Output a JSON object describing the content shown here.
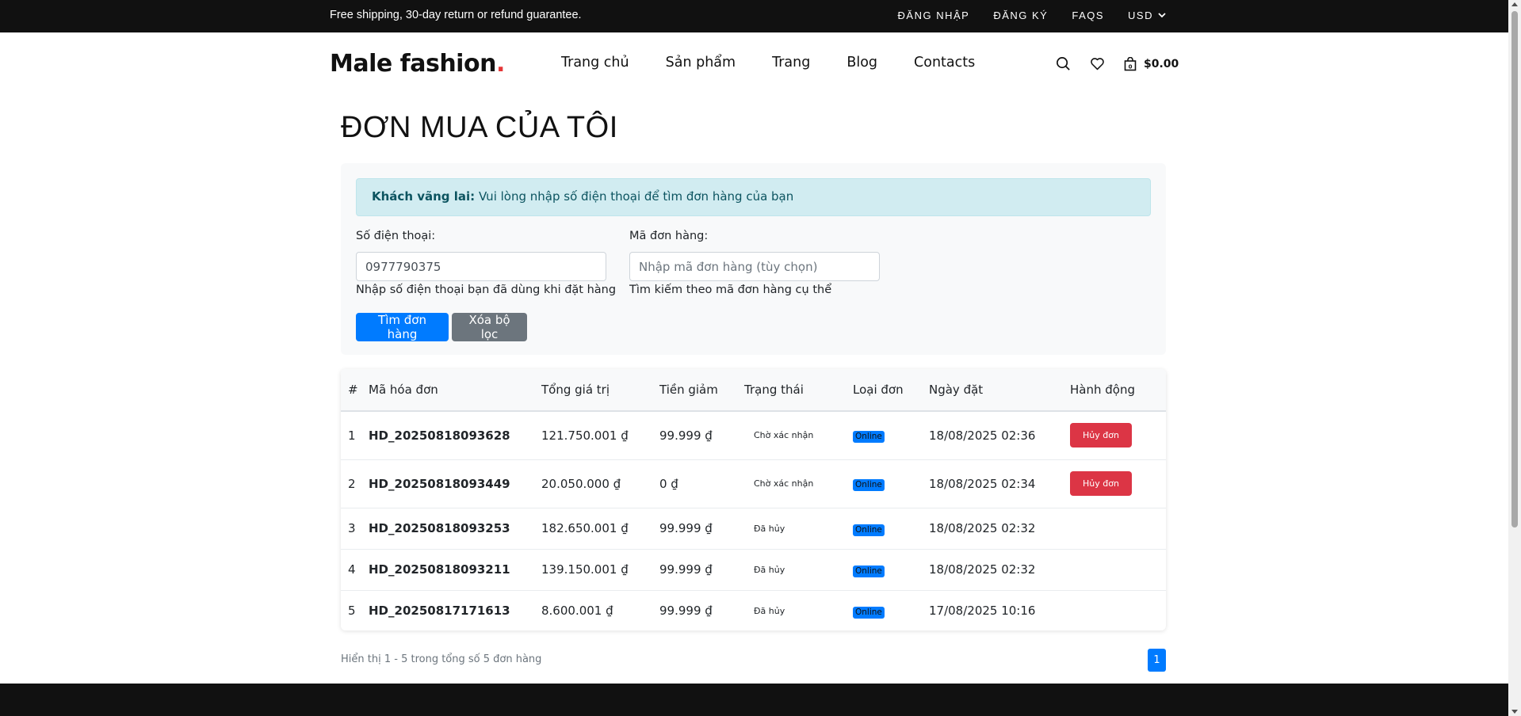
{
  "topbar": {
    "message": "Free shipping, 30-day return or refund guarantee.",
    "login": "ĐĂNG NHẬP",
    "register": "ĐĂNG KÝ",
    "faqs": "FAQS",
    "currency": "USD"
  },
  "header": {
    "logo_text": "Male fashion",
    "logo_dot": ".",
    "nav": [
      "Trang chủ",
      "Sản phẩm",
      "Trang",
      "Blog",
      "Contacts"
    ],
    "cart_total": "$0.00",
    "cart_count": "0"
  },
  "page": {
    "title": "ĐƠN MUA CỦA TÔI"
  },
  "filter": {
    "alert_bold": "Khách vãng lai:",
    "alert_text": " Vui lòng nhập số điện thoại để tìm đơn hàng của bạn",
    "phone_label": "Số điện thoại:",
    "phone_value": "0977790375",
    "phone_hint": "Nhập số điện thoại bạn đã dùng khi đặt hàng",
    "order_label": "Mã đơn hàng:",
    "order_placeholder": "Nhập mã đơn hàng (tùy chọn)",
    "order_hint": "Tìm kiếm theo mã đơn hàng cụ thể",
    "search_button": "Tìm đơn hàng",
    "clear_button": "Xóa bộ lọc"
  },
  "table": {
    "headers": [
      "#",
      "Mã hóa đơn",
      "Tổng giá trị",
      "Tiền giảm",
      "Trạng thái",
      "Loại đơn",
      "Ngày đặt",
      "Hành động"
    ],
    "rows": [
      {
        "index": "1",
        "code": "HD_20250818093628",
        "total": "121.750.001 ₫",
        "discount": "99.999 ₫",
        "status": "Chờ xác nhận",
        "type": "Online",
        "date": "18/08/2025 02:36",
        "action": "Hủy đơn"
      },
      {
        "index": "2",
        "code": "HD_20250818093449",
        "total": "20.050.000 ₫",
        "discount": "0 ₫",
        "status": "Chờ xác nhận",
        "type": "Online",
        "date": "18/08/2025 02:34",
        "action": "Hủy đơn"
      },
      {
        "index": "3",
        "code": "HD_20250818093253",
        "total": "182.650.001 ₫",
        "discount": "99.999 ₫",
        "status": "Đã hủy",
        "type": "Online",
        "date": "18/08/2025 02:32",
        "action": ""
      },
      {
        "index": "4",
        "code": "HD_20250818093211",
        "total": "139.150.001 ₫",
        "discount": "99.999 ₫",
        "status": "Đã hủy",
        "type": "Online",
        "date": "18/08/2025 02:32",
        "action": ""
      },
      {
        "index": "5",
        "code": "HD_20250817171613",
        "total": "8.600.001 ₫",
        "discount": "99.999 ₫",
        "status": "Đã hủy",
        "type": "Online",
        "date": "17/08/2025 10:16",
        "action": ""
      }
    ]
  },
  "pagination": {
    "summary": "Hiển thị 1 - 5 trong tổng số 5 đơn hàng",
    "current_page": "1"
  },
  "colors": {
    "primary": "#007bff",
    "danger": "#dc3545",
    "secondary": "#6c757d",
    "dark": "#111111",
    "logo_accent": "#e53637"
  }
}
